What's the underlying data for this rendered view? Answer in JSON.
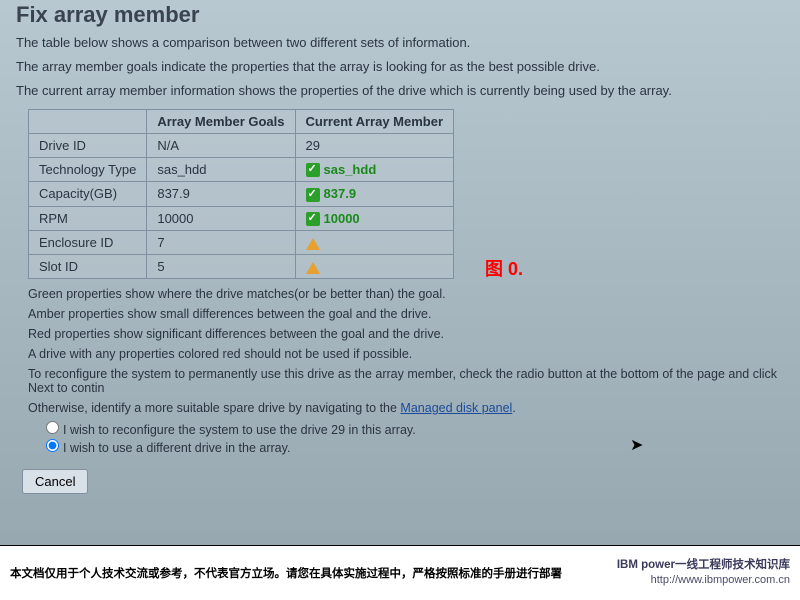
{
  "title": "Fix array member",
  "desc1": "The table below shows a comparison between two different sets of information.",
  "desc2": "The array member goals indicate the properties that the array is looking for as the best possible drive.",
  "desc3": "The current array member information shows the properties of the drive which is currently being used by the array.",
  "header_goals": "Array Member Goals",
  "header_current": "Current Array Member",
  "rows": {
    "r0_k": "Drive ID",
    "r0_g": "N/A",
    "r0_c": "29",
    "r1_k": "Technology Type",
    "r1_g": "sas_hdd",
    "r1_c": "sas_hdd",
    "r2_k": "Capacity(GB)",
    "r2_g": "837.9",
    "r2_c": "837.9",
    "r3_k": "RPM",
    "r3_g": "10000",
    "r3_c": "10000",
    "r4_k": "Enclosure ID",
    "r4_g": "7",
    "r4_c": "",
    "r5_k": "Slot ID",
    "r5_g": "5",
    "r5_c": ""
  },
  "legend": {
    "p1": "Green properties show where the drive matches(or be better than) the goal.",
    "p2": "Amber properties show small differences between the goal and the drive.",
    "p3": "Red properties show significant differences between the goal and the drive.",
    "p4": "A drive with any properties colored red should not be used if possible.",
    "p5a": "To reconfigure the system to permanently use this drive as the array member, check the radio button at the bottom of the page and click Next to contin",
    "p6a": "Otherwise, identify a more suitable spare drive by navigating to the ",
    "p6link": "Managed disk panel",
    "p6b": "."
  },
  "radio1": "I wish to reconfigure the system to use the drive 29 in this array.",
  "radio2": "I wish to use a different drive in the array.",
  "cancel": "Cancel",
  "fig_label": "图  0.",
  "footer_left": "本文档仅用于个人技术交流或参考，不代表官方立场。请您在具体实施过程中，严格按照标准的手册进行部署",
  "footer_r1": "IBM power一线工程师技术知识库",
  "footer_r2": "http://www.ibmpower.com.cn"
}
